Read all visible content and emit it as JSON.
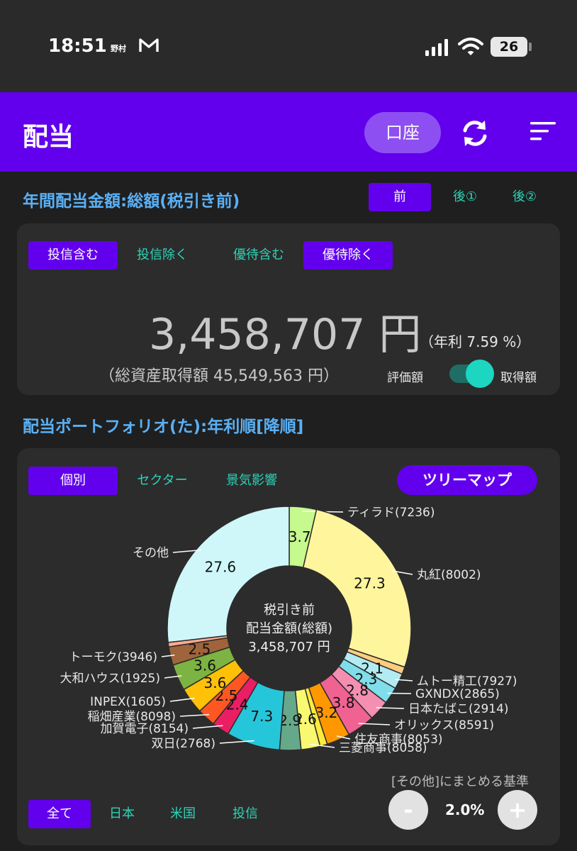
{
  "status_bar": {
    "time": "18:51",
    "carrier": "野村",
    "battery": "26"
  },
  "header": {
    "title": "配当",
    "account_label": "口座",
    "icons": [
      "refresh-icon",
      "sort-icon"
    ]
  },
  "annual": {
    "title": "年間配当金額:総額(税引き前)",
    "tabs": [
      "前",
      "後①",
      "後②"
    ],
    "filters": [
      "投信含む",
      "投信除く",
      "優待含む",
      "優待除く"
    ],
    "amount": "3,458,707 円",
    "yield": "（年利 7.59 %）",
    "acquisition_total": "（総資産取得額 45,549,563 円）",
    "toggle_left": "評価額",
    "toggle_right": "取得額",
    "toggle_state": "取得額"
  },
  "portfolio": {
    "title": "配当ポートフォリオ(た):年利順[降順]",
    "tabs": [
      "個別",
      "セクター",
      "景気影響"
    ],
    "treemap_label": "ツリーマップ",
    "center_lines": [
      "税引き前",
      "配当金額(総額)",
      "3,458,707 円"
    ],
    "region_tabs": [
      "全て",
      "日本",
      "米国",
      "投信"
    ],
    "group_label": "[その他]にまとめる基準",
    "minus_label": "-",
    "plus_label": "+",
    "threshold": "2.0%"
  },
  "colors": {
    "accent": "#6200ee",
    "teal": "#2ed3b7",
    "heading": "#5ab0f5"
  },
  "chart_data": {
    "type": "pie",
    "title": "",
    "slices": [
      {
        "label": "ティラド(7236)",
        "value": 3.7,
        "value_label": "3.7",
        "color": "#c6f98e"
      },
      {
        "label": "丸紅(8002)",
        "value": 27.3,
        "value_label": "27.3",
        "color": "#fff59d"
      },
      {
        "label": "",
        "value": 1.0,
        "value_label": "",
        "color": "#ffcc80"
      },
      {
        "label": "ムトー精工(7927)",
        "value": 2.1,
        "value_label": "2.1",
        "color": "#b2ebf2"
      },
      {
        "label": "GXNDX(2865)",
        "value": 2.3,
        "value_label": "2.3",
        "color": "#80deea"
      },
      {
        "label": "日本たばこ(2914)",
        "value": 2.8,
        "value_label": "2.8",
        "color": "#f48fb1"
      },
      {
        "label": "オリックス(8591)",
        "value": 3.8,
        "value_label": "3.8",
        "color": "#f06292"
      },
      {
        "label": "住友商事(8053)",
        "value": 3.2,
        "value_label": "3.2",
        "color": "#ff9800"
      },
      {
        "label": "",
        "value": 1.0,
        "value_label": "",
        "color": "#ffeb3b"
      },
      {
        "label": "三菱商事(8058)",
        "value": 2.6,
        "value_label": "2.6",
        "color": "#f9f871"
      },
      {
        "label": "",
        "value": 2.9,
        "value_label": "2.9",
        "color": "#66a88a"
      },
      {
        "label": "双日(2768)",
        "value": 7.3,
        "value_label": "7.3",
        "color": "#26c6da"
      },
      {
        "label": "加賀電子(8154)",
        "value": 2.4,
        "value_label": "2.4",
        "color": "#e91e63"
      },
      {
        "label": "稲畑産業(8098)",
        "value": 2.5,
        "value_label": "2.5",
        "color": "#ff5722"
      },
      {
        "label": "INPEX(1605)",
        "value": 3.6,
        "value_label": "3.6",
        "color": "#ffc107"
      },
      {
        "label": "大和ハウス(1925)",
        "value": 3.6,
        "value_label": "3.6",
        "color": "#7cb342"
      },
      {
        "label": "トーモク(3946)",
        "value": 2.5,
        "value_label": "2.5",
        "color": "#a0643c"
      },
      {
        "label": "",
        "value": 0.6,
        "value_label": "",
        "color": "#ffab91"
      },
      {
        "label": "その他",
        "value": 27.6,
        "value_label": "27.6",
        "color": "#cff7fa"
      }
    ]
  }
}
